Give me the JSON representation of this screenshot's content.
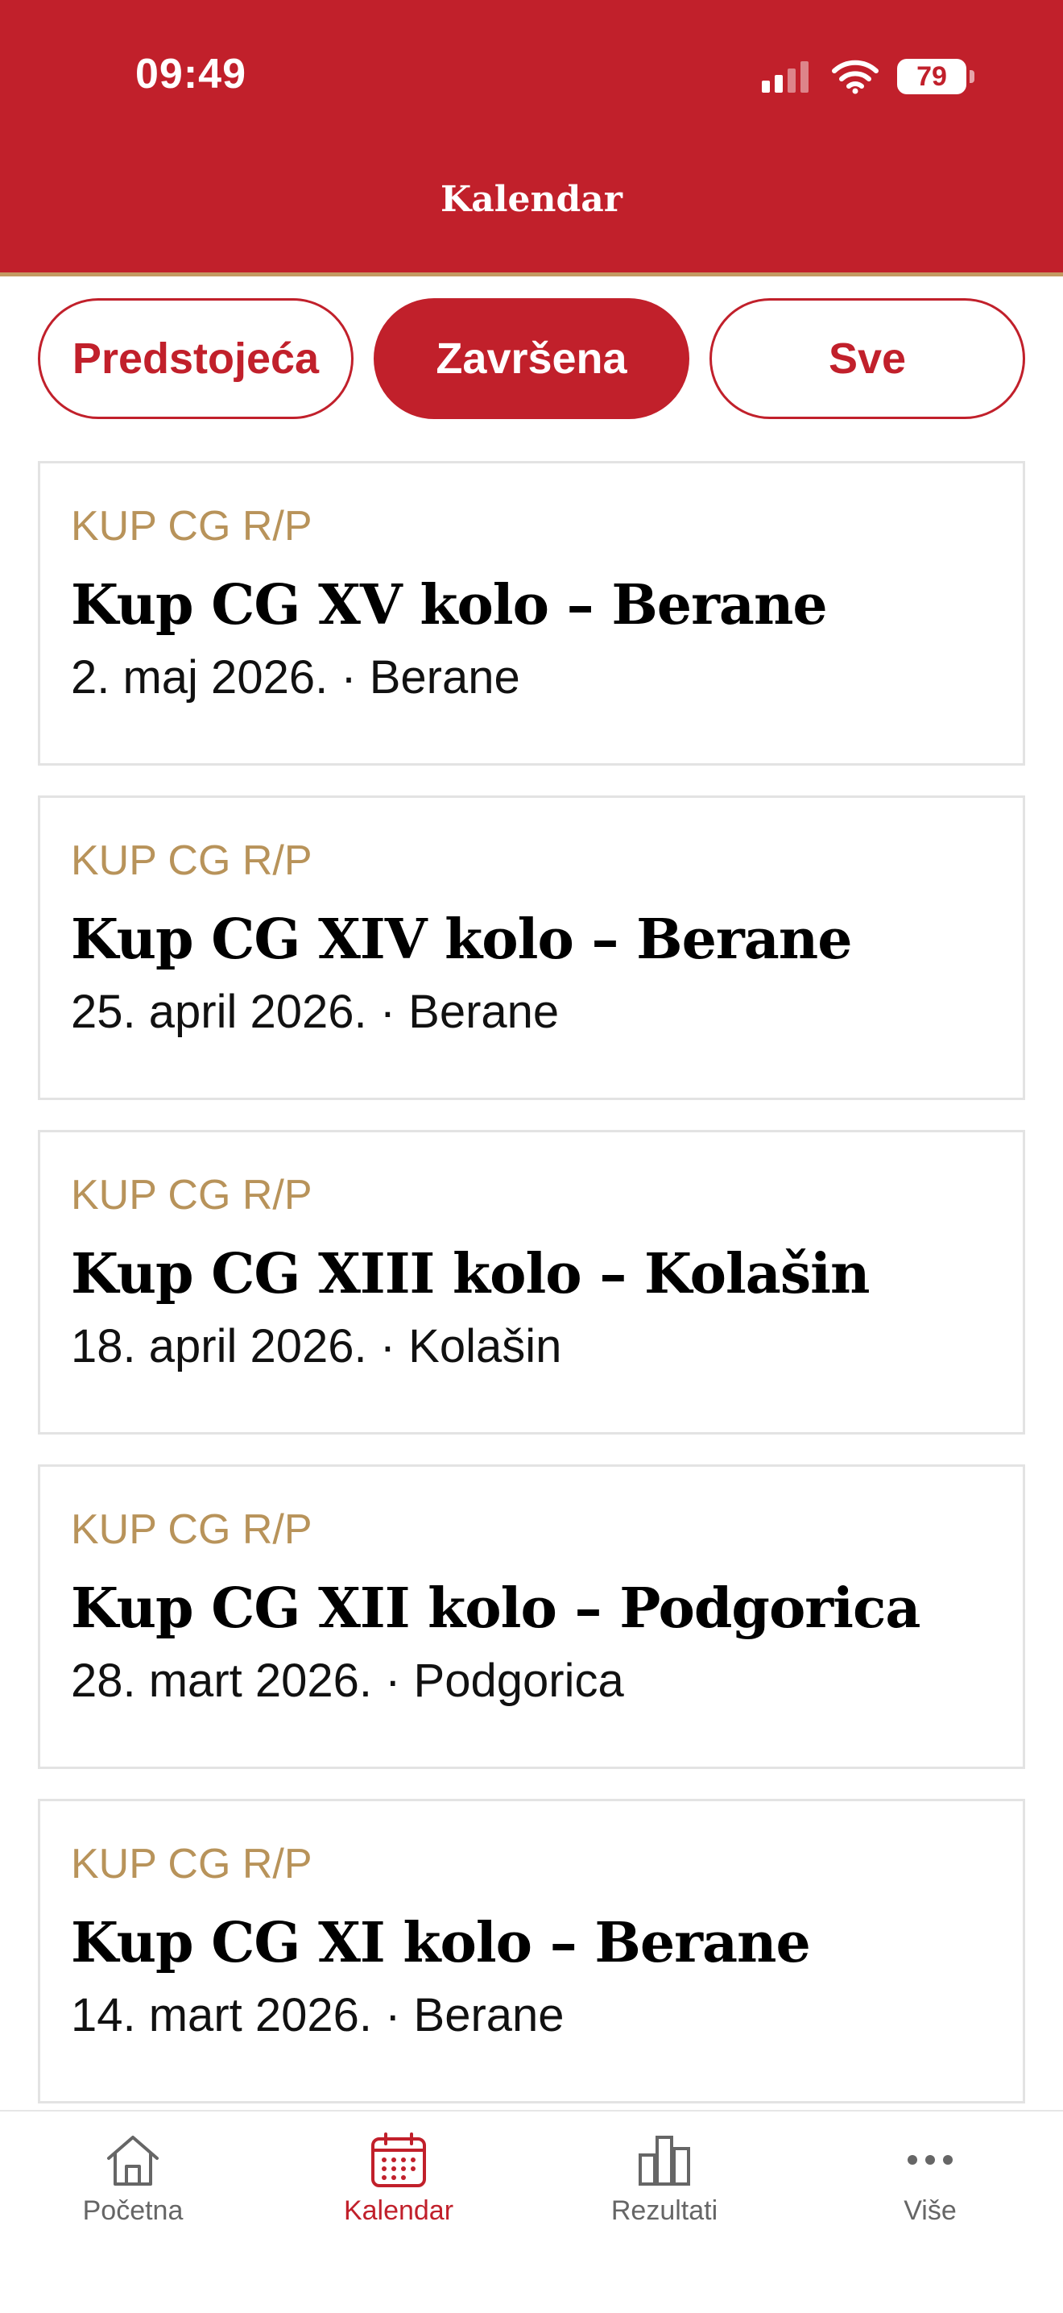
{
  "status_bar": {
    "time": "09:49",
    "battery": "79"
  },
  "header": {
    "title": "Kalendar"
  },
  "filters": [
    {
      "label": "Predstojeća",
      "active": false
    },
    {
      "label": "Završena",
      "active": true
    },
    {
      "label": "Sve",
      "active": false
    }
  ],
  "events": [
    {
      "category": "KUP CG R/P",
      "title": "Kup CG XV kolo – Berane",
      "meta": "2. maj 2026. · Berane"
    },
    {
      "category": "KUP CG R/P",
      "title": "Kup CG XIV kolo – Berane",
      "meta": "25. april 2026. · Berane"
    },
    {
      "category": "KUP CG R/P",
      "title": "Kup CG XIII kolo – Kolašin",
      "meta": "18. april 2026. · Kolašin"
    },
    {
      "category": "KUP CG R/P",
      "title": "Kup CG XII kolo – Podgorica",
      "meta": "28. mart 2026. · Podgorica"
    },
    {
      "category": "KUP CG R/P",
      "title": "Kup CG XI kolo – Berane",
      "meta": "14. mart 2026. · Berane"
    }
  ],
  "tabbar": {
    "items": [
      {
        "label": "Početna",
        "icon": "home-icon",
        "active": false
      },
      {
        "label": "Kalendar",
        "icon": "calendar-icon",
        "active": true
      },
      {
        "label": "Rezultati",
        "icon": "bar-chart-icon",
        "active": false
      },
      {
        "label": "Više",
        "icon": "more-icon",
        "active": false
      }
    ]
  },
  "colors": {
    "brand_red": "#c1202b",
    "category_gold": "#b8935a",
    "header_accent": "#c49a62",
    "inactive_tab": "#666666"
  }
}
